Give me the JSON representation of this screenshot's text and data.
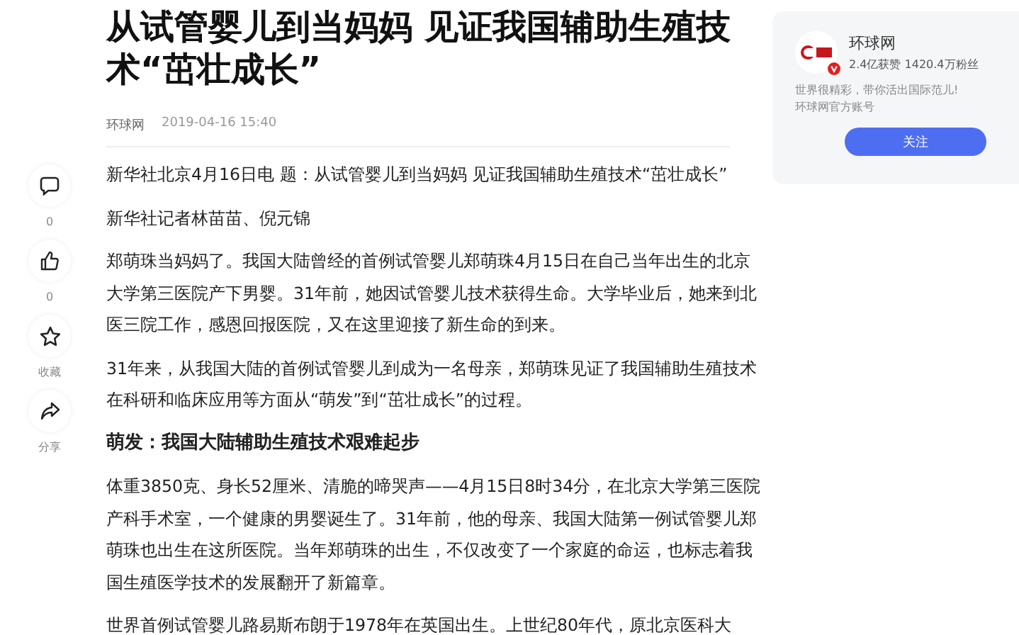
{
  "article": {
    "title": "从试管婴儿到当妈妈 见证我国辅助生殖技术“茁壮成长”",
    "source": "环球网",
    "time": "2019-04-16 15:40",
    "paragraphs": [
      {
        "kind": "text",
        "text": "新华社北京4月16日电 题：从试管婴儿到当妈妈 见证我国辅助生殖技术“茁壮成长”"
      },
      {
        "kind": "text",
        "text": "新华社记者林苗苗、倪元锦"
      },
      {
        "kind": "text",
        "text": "郑萌珠当妈妈了。我国大陆曾经的首例试管婴儿郑萌珠4月15日在自己当年出生的北京大学第三医院产下男婴。31年前，她因试管婴儿技术获得生命。大学毕业后，她来到北医三院工作，感恩回报医院，又在这里迎接了新生命的到来。"
      },
      {
        "kind": "text",
        "text": "31年来，从我国大陆的首例试管婴儿到成为一名母亲，郑萌珠见证了我国辅助生殖技术在科研和临床应用等方面从“萌发”到“茁壮成长”的过程。"
      },
      {
        "kind": "heading",
        "text": "萌发：我国大陆辅助生殖技术艰难起步"
      },
      {
        "kind": "text",
        "text": "体重3850克、身长52厘米、清脆的啼哭声——4月15日8时34分，在北京大学第三医院产科手术室，一个健康的男婴诞生了。31年前，他的母亲、我国大陆第一例试管婴儿郑萌珠也出生在这所医院。当年郑萌珠的出生，不仅改变了一个家庭的命运，也标志着我国生殖医学技术的发展翻开了新篇章。"
      },
      {
        "kind": "text",
        "text": "世界首例试管婴儿路易斯布朗于1978年在英国出生。上世纪80年代，原北京医科大"
      }
    ]
  },
  "actions": [
    {
      "kind": "comment",
      "label": "0"
    },
    {
      "kind": "like",
      "label": "0"
    },
    {
      "kind": "star",
      "label": "收藏"
    },
    {
      "kind": "share",
      "label": "分享"
    }
  ],
  "author": {
    "name": "环球网",
    "verified": true,
    "stats": "2.4亿获赞 1420.4万粉丝",
    "bio": "世界很精彩，带你活出国际范儿!",
    "note": "环球网官方账号",
    "button": "关注"
  }
}
